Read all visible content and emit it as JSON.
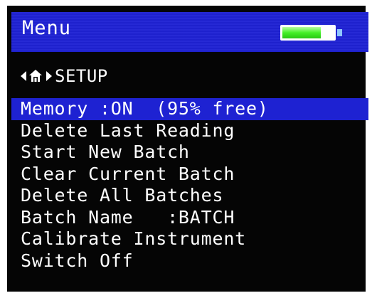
{
  "titlebar": {
    "title": "Menu",
    "battery_icon": "battery-icon",
    "battery_level": 0.75,
    "color": "#1f22d4"
  },
  "breadcrumb": {
    "left_icon": "triangle-left-icon",
    "home_icon": "home-icon",
    "right_icon": "triangle-right-icon",
    "label": "SETUP"
  },
  "menu": {
    "selected_index": 0,
    "selected_color": "#1e22d2",
    "items": [
      {
        "label": "Memory :ON  (95% free)"
      },
      {
        "label": "Delete Last Reading"
      },
      {
        "label": "Start New Batch"
      },
      {
        "label": "Clear Current Batch"
      },
      {
        "label": "Delete All Batches"
      },
      {
        "label": "Batch Name   :BATCH"
      },
      {
        "label": "Calibrate Instrument"
      },
      {
        "label": "Switch Off"
      }
    ]
  }
}
